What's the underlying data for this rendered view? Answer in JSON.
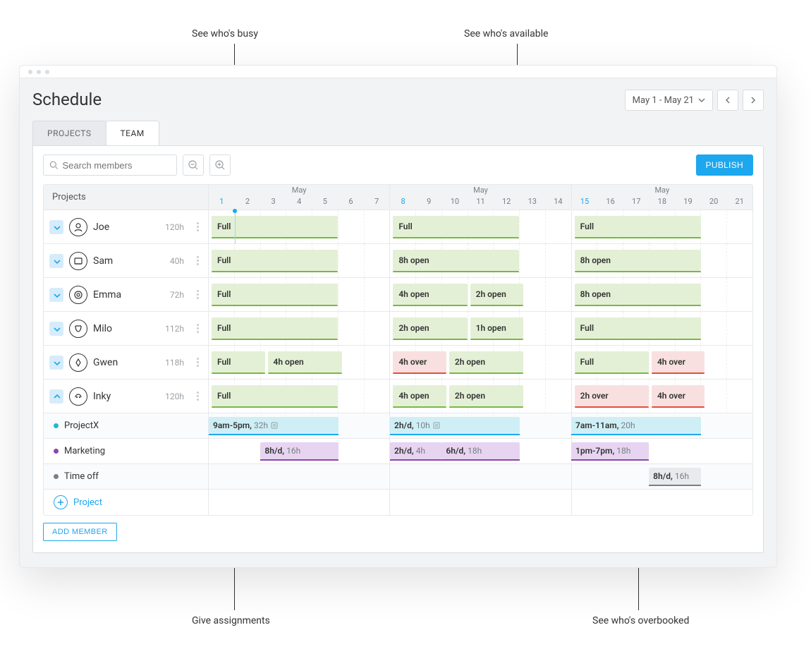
{
  "annotations": {
    "busy": "See who's busy",
    "available": "See who's available",
    "assign": "Give assignments",
    "over": "See who's overbooked"
  },
  "header": {
    "title": "Schedule",
    "range_label": "May 1 - May 21"
  },
  "tabs": {
    "projects": "PROJECTS",
    "team": "TEAM"
  },
  "toolbar": {
    "search_placeholder": "Search members",
    "publish": "PUBLISH"
  },
  "grid": {
    "left_header": "Projects",
    "month": "May",
    "weeks": [
      {
        "days": [
          "1",
          "2",
          "3",
          "4",
          "5",
          "6",
          "7"
        ]
      },
      {
        "days": [
          "8",
          "9",
          "10",
          "11",
          "12",
          "13",
          "14"
        ]
      },
      {
        "days": [
          "15",
          "16",
          "17",
          "18",
          "19",
          "20",
          "21"
        ]
      }
    ],
    "add_project": "Project",
    "add_member": "ADD MEMBER"
  },
  "members": [
    {
      "name": "Joe",
      "hours": "120h",
      "weeks": [
        [
          {
            "t": "Full",
            "k": "full",
            "span": 5
          }
        ],
        [
          {
            "t": "Full",
            "k": "full",
            "span": 5
          }
        ],
        [
          {
            "t": "Full",
            "k": "full",
            "span": 5
          }
        ]
      ]
    },
    {
      "name": "Sam",
      "hours": "40h",
      "weeks": [
        [
          {
            "t": "Full",
            "k": "full",
            "span": 5
          }
        ],
        [
          {
            "t": "8h open",
            "k": "open",
            "span": 5
          }
        ],
        [
          {
            "t": "8h open",
            "k": "open",
            "span": 5
          }
        ]
      ]
    },
    {
      "name": "Emma",
      "hours": "72h",
      "weeks": [
        [
          {
            "t": "Full",
            "k": "full",
            "span": 5
          }
        ],
        [
          {
            "t": "4h open",
            "k": "open",
            "span": 3
          },
          {
            "t": "2h open",
            "k": "open",
            "span": 2
          }
        ],
        [
          {
            "t": "8h open",
            "k": "open",
            "span": 5
          }
        ]
      ]
    },
    {
      "name": "Milo",
      "hours": "112h",
      "weeks": [
        [
          {
            "t": "Full",
            "k": "full",
            "span": 5
          }
        ],
        [
          {
            "t": "2h open",
            "k": "open",
            "span": 3
          },
          {
            "t": "1h open",
            "k": "open",
            "span": 2
          }
        ],
        [
          {
            "t": "Full",
            "k": "full",
            "span": 5
          }
        ]
      ]
    },
    {
      "name": "Gwen",
      "hours": "118h",
      "weeks": [
        [
          {
            "t": "Full",
            "k": "full",
            "span": 2
          },
          {
            "t": "4h open",
            "k": "open",
            "span": 3
          }
        ],
        [
          {
            "t": "4h over",
            "k": "over",
            "span": 2
          },
          {
            "t": "2h open",
            "k": "open",
            "span": 3
          }
        ],
        [
          {
            "t": "Full",
            "k": "full",
            "span": 3
          },
          {
            "t": "4h over",
            "k": "over",
            "span": 2
          }
        ]
      ]
    },
    {
      "name": "Inky",
      "hours": "120h",
      "expanded": true,
      "weeks": [
        [
          {
            "t": "Full",
            "k": "full",
            "span": 5
          }
        ],
        [
          {
            "t": "4h open",
            "k": "open",
            "span": 2
          },
          {
            "t": "2h open",
            "k": "open",
            "span": 3
          }
        ],
        [
          {
            "t": "2h over",
            "k": "over",
            "span": 3
          },
          {
            "t": "4h over",
            "k": "over",
            "span": 2
          }
        ]
      ]
    }
  ],
  "subprojects": [
    {
      "name": "ProjectX",
      "color": "#1db9d1",
      "tint": true,
      "bars": [
        {
          "week": 0,
          "start": 0,
          "span": 5,
          "label": "9am-5pm,",
          "extra": "32h",
          "kind": "cyan",
          "note": true
        },
        {
          "week": 1,
          "start": 0,
          "span": 5,
          "label": "2h/d,",
          "extra": "10h",
          "kind": "cyan",
          "note": true
        },
        {
          "week": 2,
          "start": 0,
          "span": 5,
          "label": "7am-11am,",
          "extra": "20h",
          "kind": "cyan",
          "hatchTail": 2
        }
      ]
    },
    {
      "name": "Marketing",
      "color": "#8e44ad",
      "bars": [
        {
          "week": 0,
          "start": 2,
          "span": 3,
          "label": "8h/d,",
          "extra": "16h",
          "kind": "purple"
        },
        {
          "week": 1,
          "start": 0,
          "span": 2,
          "label": "2h/d,",
          "extra": "4h",
          "kind": "purple"
        },
        {
          "week": 1,
          "start": 2,
          "span": 3,
          "label": "6h/d,",
          "extra": "18h",
          "kind": "purple"
        },
        {
          "week": 2,
          "start": 0,
          "span": 3,
          "label": "1pm-7pm,",
          "extra": "18h",
          "kind": "purple"
        }
      ]
    },
    {
      "name": "Time off",
      "color": "#7a7f85",
      "tint": true,
      "bars": [
        {
          "week": 2,
          "start": 3,
          "span": 2,
          "label": "8h/d,",
          "extra": "16h",
          "kind": "grey"
        }
      ]
    }
  ],
  "colors": {
    "accent": "#1da7ee"
  }
}
